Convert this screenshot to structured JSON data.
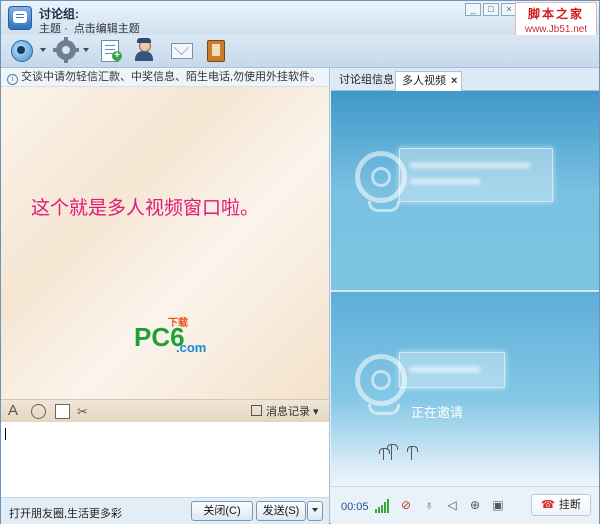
{
  "window": {
    "group_title": "讨论组:",
    "topic_label": "主题 ·",
    "topic_edit_link": "点击编辑主题",
    "controls": [
      "_",
      "□",
      "×"
    ],
    "watermark_line1": "脚本之家",
    "watermark_line2": "www.Jb51.net"
  },
  "toolbar": {
    "icons": [
      "webcam-icon",
      "settings-icon",
      "new-doc-icon",
      "user-icon",
      "mail-icon",
      "notebook-icon"
    ]
  },
  "left": {
    "notice": "交谈中请勿轻信汇款、中奖信息、陌生电话,勿使用外挂软件。",
    "chat_message": "这个就是多人视频窗口啦。",
    "logo": {
      "pc6": "PC6",
      "sub": "下载",
      "com": ".com"
    },
    "format_bar": {
      "font": "A",
      "history": "消息记录"
    },
    "bottom_tip": "打开朋友圈,生活更多彩",
    "close_label": "关闭(C)",
    "send_label": "发送(S)"
  },
  "right": {
    "tabs": [
      "讨论组信息",
      "多人视频"
    ],
    "tab_close": "×",
    "inviting": "正在邀请",
    "timer": "00:05",
    "hangup_label": "挂断",
    "hangup_glyph": "☎"
  },
  "colors": {
    "chat_message": "#e0197a",
    "pc6_logo": "#1fa13a",
    "hangup": "#d42a2a"
  }
}
